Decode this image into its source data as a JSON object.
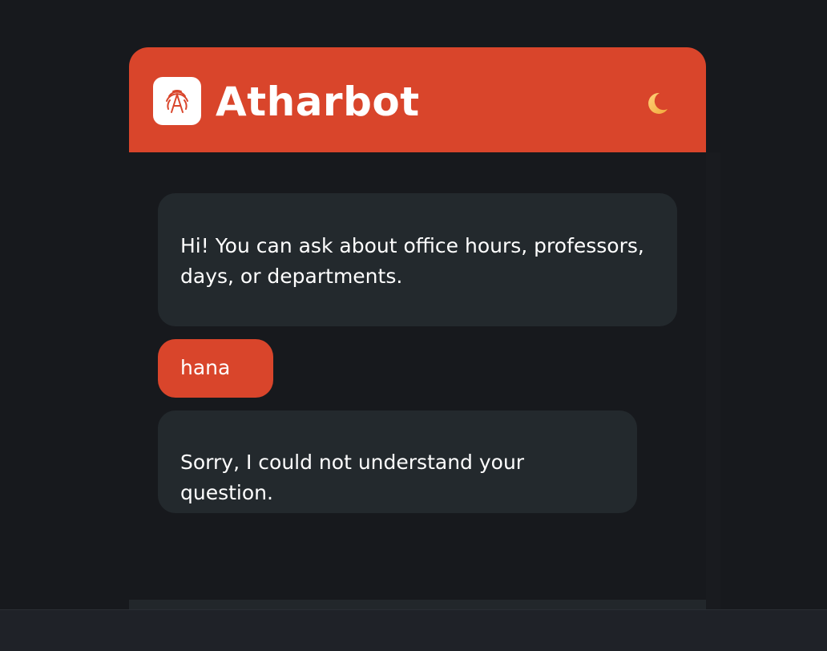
{
  "app": {
    "title": "Atharbot",
    "logo_icon": "fingerprint-a-icon",
    "theme_toggle_icon": "crescent-moon-icon"
  },
  "colors": {
    "background": "#17191d",
    "accent": "#d9452b",
    "bot_bubble": "#23292d",
    "text": "#ffffff"
  },
  "messages": [
    {
      "sender": "bot",
      "text": "Hi! You can ask about office hours, professors, days, or departments."
    },
    {
      "sender": "user",
      "text": "hana"
    },
    {
      "sender": "bot",
      "text": "Sorry, I could not understand your question."
    }
  ]
}
